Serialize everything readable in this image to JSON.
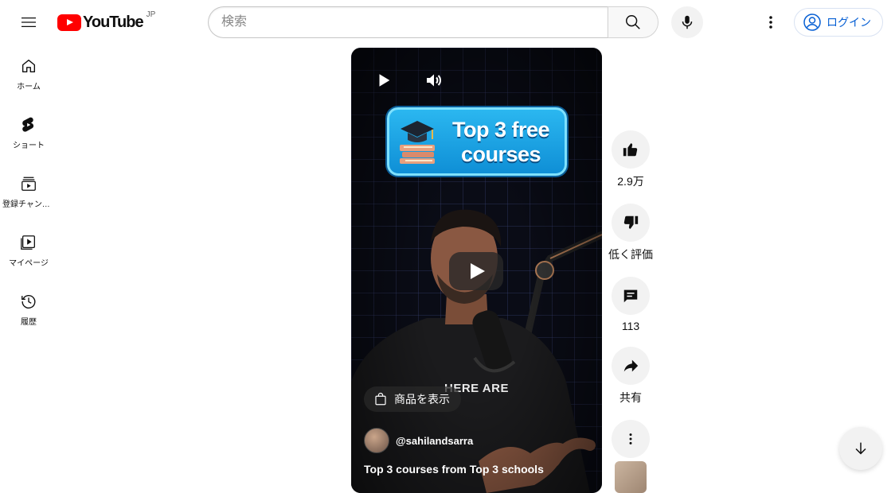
{
  "header": {
    "logo_text": "YouTube",
    "country_code": "JP",
    "search_placeholder": "検索",
    "login_label": "ログイン",
    "icons": {
      "menu": "menu-icon",
      "search": "search-icon",
      "mic": "mic-icon",
      "more": "more-vert-icon",
      "account": "account-circle-icon"
    }
  },
  "sidebar": {
    "items": [
      {
        "label": "ホーム",
        "icon": "home-icon"
      },
      {
        "label": "ショート",
        "icon": "shorts-icon"
      },
      {
        "label": "登録チャンネル",
        "icon": "subscriptions-icon"
      },
      {
        "label": "マイページ",
        "icon": "library-icon"
      },
      {
        "label": "履歴",
        "icon": "history-icon"
      }
    ]
  },
  "short": {
    "title_card_line1": "Top 3 free",
    "title_card_line2": "courses",
    "overlay_caption": "HERE ARE",
    "shop_chip_label": "商品を表示",
    "channel_handle": "@sahilandsarra",
    "video_title": "Top 3 courses from Top 3 schools"
  },
  "actions": {
    "like_count": "2.9万",
    "dislike_label": "低く評価",
    "comment_count": "113",
    "share_label": "共有"
  },
  "colors": {
    "brand_red": "#ff0000",
    "link_blue": "#065fd4",
    "button_gray": "#f2f2f2"
  }
}
